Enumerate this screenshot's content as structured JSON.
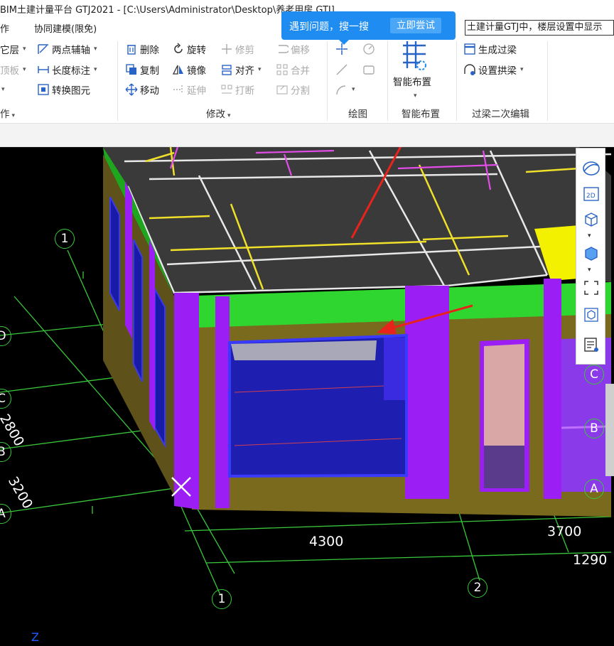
{
  "window": {
    "title": "BIM土建计量平台 GTJ2021 - [C:\\Users\\Administrator\\Desktop\\养老用房.GTJ]"
  },
  "menu": {
    "item1": "作",
    "item2": "协同建模(限免)"
  },
  "tooltip": {
    "text": "遇到问题，搜一搜",
    "button": "立即尝试"
  },
  "search": {
    "value": "土建计量GTJ中，楼层设置中显示"
  },
  "ribbon": {
    "left": {
      "copy_layer": "它层",
      "slab": "顶板",
      "two_point_axis": "两点辅轴",
      "length_dim": "长度标注",
      "convert": "转换图元"
    },
    "modify": {
      "delete": "删除",
      "rotate": "旋转",
      "trim": "修剪",
      "offset": "偏移",
      "copy": "复制",
      "mirror": "镜像",
      "align": "对齐",
      "merge": "合并",
      "move": "移动",
      "extend": "延伸",
      "break": "打断",
      "split": "分割"
    },
    "smart": {
      "label": "智能布置"
    },
    "lintel": {
      "generate": "生成过梁",
      "arch": "设置拱梁"
    },
    "groups": {
      "ops": "作",
      "modify": "修改",
      "draw": "绘图",
      "smart": "智能布置",
      "lintel": "过梁二次编辑"
    }
  },
  "viewport": {
    "dims": {
      "d4300": "4300",
      "d3700": "3700",
      "d1290": "1290",
      "d3200": "3200",
      "d2800": "2800"
    },
    "axes": {
      "a1_top": "1",
      "a1_bottom": "1",
      "a2": "2",
      "D": "D",
      "C_left": "C",
      "B_left": "B",
      "A_left": "A",
      "C_right": "C",
      "B_right": "B",
      "A_right": "A"
    },
    "z_axis": "Z"
  },
  "colors": {
    "tooltip_bg": "#1e8cf0",
    "grid_green": "#39c83a",
    "wall_olive": "#7a6a1e",
    "column_purple": "#9b1ff5",
    "beam_green": "#2fd62f",
    "window_blue": "#1a1aa8",
    "annotation_red": "#e8231c"
  },
  "view_toolbar": [
    "orbit-icon",
    "2d-icon",
    "3d-box-icon",
    "solid-box-icon",
    "fullscreen-icon",
    "cube-view-icon",
    "display-settings-icon"
  ]
}
